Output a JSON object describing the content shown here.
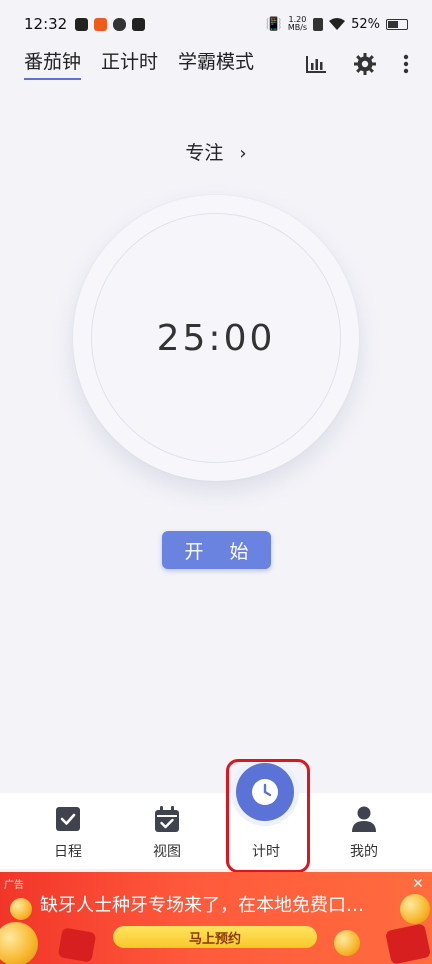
{
  "status_bar": {
    "time": "12:32",
    "net_speed_top": "1.20",
    "net_speed_bottom": "MB/s",
    "battery": "52%"
  },
  "top_tabs": [
    {
      "label": "番茄钟",
      "active": true
    },
    {
      "label": "正计时",
      "active": false
    },
    {
      "label": "学霸模式",
      "active": false
    }
  ],
  "toolbar_icons": [
    "bar-chart-icon",
    "gear-icon",
    "more-vertical-icon"
  ],
  "focus": {
    "label": "专注",
    "chevron": "›"
  },
  "timer": {
    "display": "25:00"
  },
  "start_button": {
    "label": "开 始"
  },
  "bottom_nav": [
    {
      "label": "日程",
      "icon": "checkbox-icon"
    },
    {
      "label": "视图",
      "icon": "calendar-check-icon"
    },
    {
      "label": "计时",
      "icon": "clock-icon",
      "active": true
    },
    {
      "label": "我的",
      "icon": "person-icon"
    }
  ],
  "ad": {
    "tag": "广告",
    "text": "缺牙人士种牙专场来了，在本地免费口…",
    "button": "马上预约"
  },
  "colors": {
    "accent": "#5b72d6",
    "start_button": "#6a82e0",
    "highlight": "#e0141e",
    "background": "#f3f3f8",
    "ad_background": "#f2352a"
  }
}
